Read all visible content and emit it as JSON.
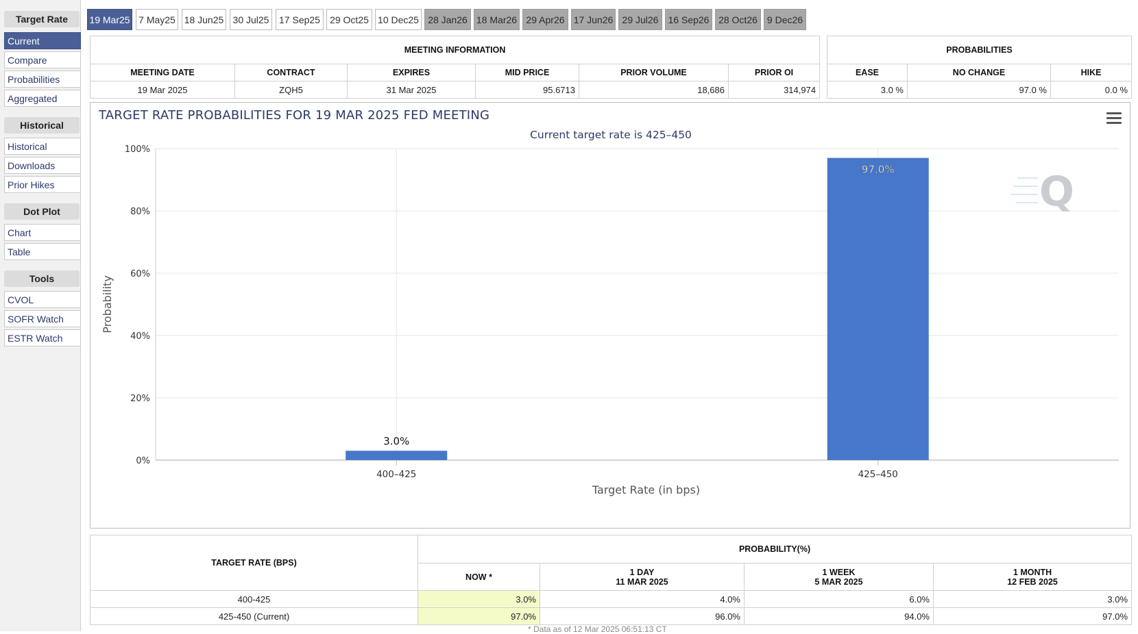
{
  "sidebar": {
    "groups": [
      {
        "header": "Target Rate",
        "items": [
          "Current",
          "Compare",
          "Probabilities",
          "Aggregated"
        ],
        "active": 0
      },
      {
        "header": "Historical",
        "items": [
          "Historical",
          "Downloads",
          "Prior Hikes"
        ]
      },
      {
        "header": "Dot Plot",
        "items": [
          "Chart",
          "Table"
        ]
      },
      {
        "header": "Tools",
        "items": [
          "CVOL",
          "SOFR Watch",
          "ESTR Watch"
        ]
      }
    ]
  },
  "tabs": [
    {
      "label": "19 Mar25",
      "state": "active"
    },
    {
      "label": "7 May25",
      "state": "normal"
    },
    {
      "label": "18 Jun25",
      "state": "normal"
    },
    {
      "label": "30 Jul25",
      "state": "normal"
    },
    {
      "label": "17 Sep25",
      "state": "normal"
    },
    {
      "label": "29 Oct25",
      "state": "normal"
    },
    {
      "label": "10 Dec25",
      "state": "normal"
    },
    {
      "label": "28 Jan26",
      "state": "future"
    },
    {
      "label": "18 Mar26",
      "state": "future"
    },
    {
      "label": "29 Apr26",
      "state": "future"
    },
    {
      "label": "17 Jun26",
      "state": "future"
    },
    {
      "label": "29 Jul26",
      "state": "future"
    },
    {
      "label": "16 Sep26",
      "state": "future"
    },
    {
      "label": "28 Oct26",
      "state": "future"
    },
    {
      "label": "9 Dec26",
      "state": "future"
    }
  ],
  "meeting_info": {
    "title": "MEETING INFORMATION",
    "headers": [
      "MEETING DATE",
      "CONTRACT",
      "EXPIRES",
      "MID PRICE",
      "PRIOR VOLUME",
      "PRIOR OI"
    ],
    "values": [
      "19 Mar 2025",
      "ZQH5",
      "31 Mar 2025",
      "95.6713",
      "18,686",
      "314,974"
    ]
  },
  "probabilities": {
    "title": "PROBABILITIES",
    "headers": [
      "EASE",
      "NO CHANGE",
      "HIKE"
    ],
    "values": [
      "3.0 %",
      "97.0 %",
      "0.0 %"
    ]
  },
  "chart": {
    "title": "TARGET RATE PROBABILITIES FOR 19 MAR 2025 FED MEETING",
    "subtitle": "Current target rate is 425–450"
  },
  "chart_data": {
    "type": "bar",
    "title": "TARGET RATE PROBABILITIES FOR 19 MAR 2025 FED MEETING",
    "subtitle": "Current target rate is 425–450",
    "categories": [
      "400–425",
      "425–450"
    ],
    "values": [
      3.0,
      97.0
    ],
    "data_labels": [
      "3.0%",
      "97.0%"
    ],
    "xlabel": "Target Rate (in bps)",
    "ylabel": "Probability",
    "ylim": [
      0,
      100
    ],
    "yticks": [
      "0%",
      "20%",
      "40%",
      "60%",
      "80%",
      "100%"
    ],
    "grid": true,
    "bar_color": "#4677c8"
  },
  "bottom_table": {
    "rate_header": "TARGET RATE (BPS)",
    "prob_header": "PROBABILITY(%)",
    "columns": [
      {
        "line1": "NOW *",
        "line2": ""
      },
      {
        "line1": "1 DAY",
        "line2": "11 MAR 2025"
      },
      {
        "line1": "1 WEEK",
        "line2": "5 MAR 2025"
      },
      {
        "line1": "1 MONTH",
        "line2": "12 FEB 2025"
      }
    ],
    "rows": [
      {
        "rate": "400-425",
        "values": [
          "3.0%",
          "4.0%",
          "6.0%",
          "3.0%"
        ]
      },
      {
        "rate": "425-450 (Current)",
        "values": [
          "97.0%",
          "96.0%",
          "94.0%",
          "97.0%"
        ]
      }
    ],
    "footnote": "* Data as of 12 Mar 2025 06:51:13 CT"
  },
  "colors": {
    "accent": "#4a5f95",
    "bar": "#4677c8",
    "highlight": "#f4fbc8",
    "watermark": "#c9cdd2"
  }
}
